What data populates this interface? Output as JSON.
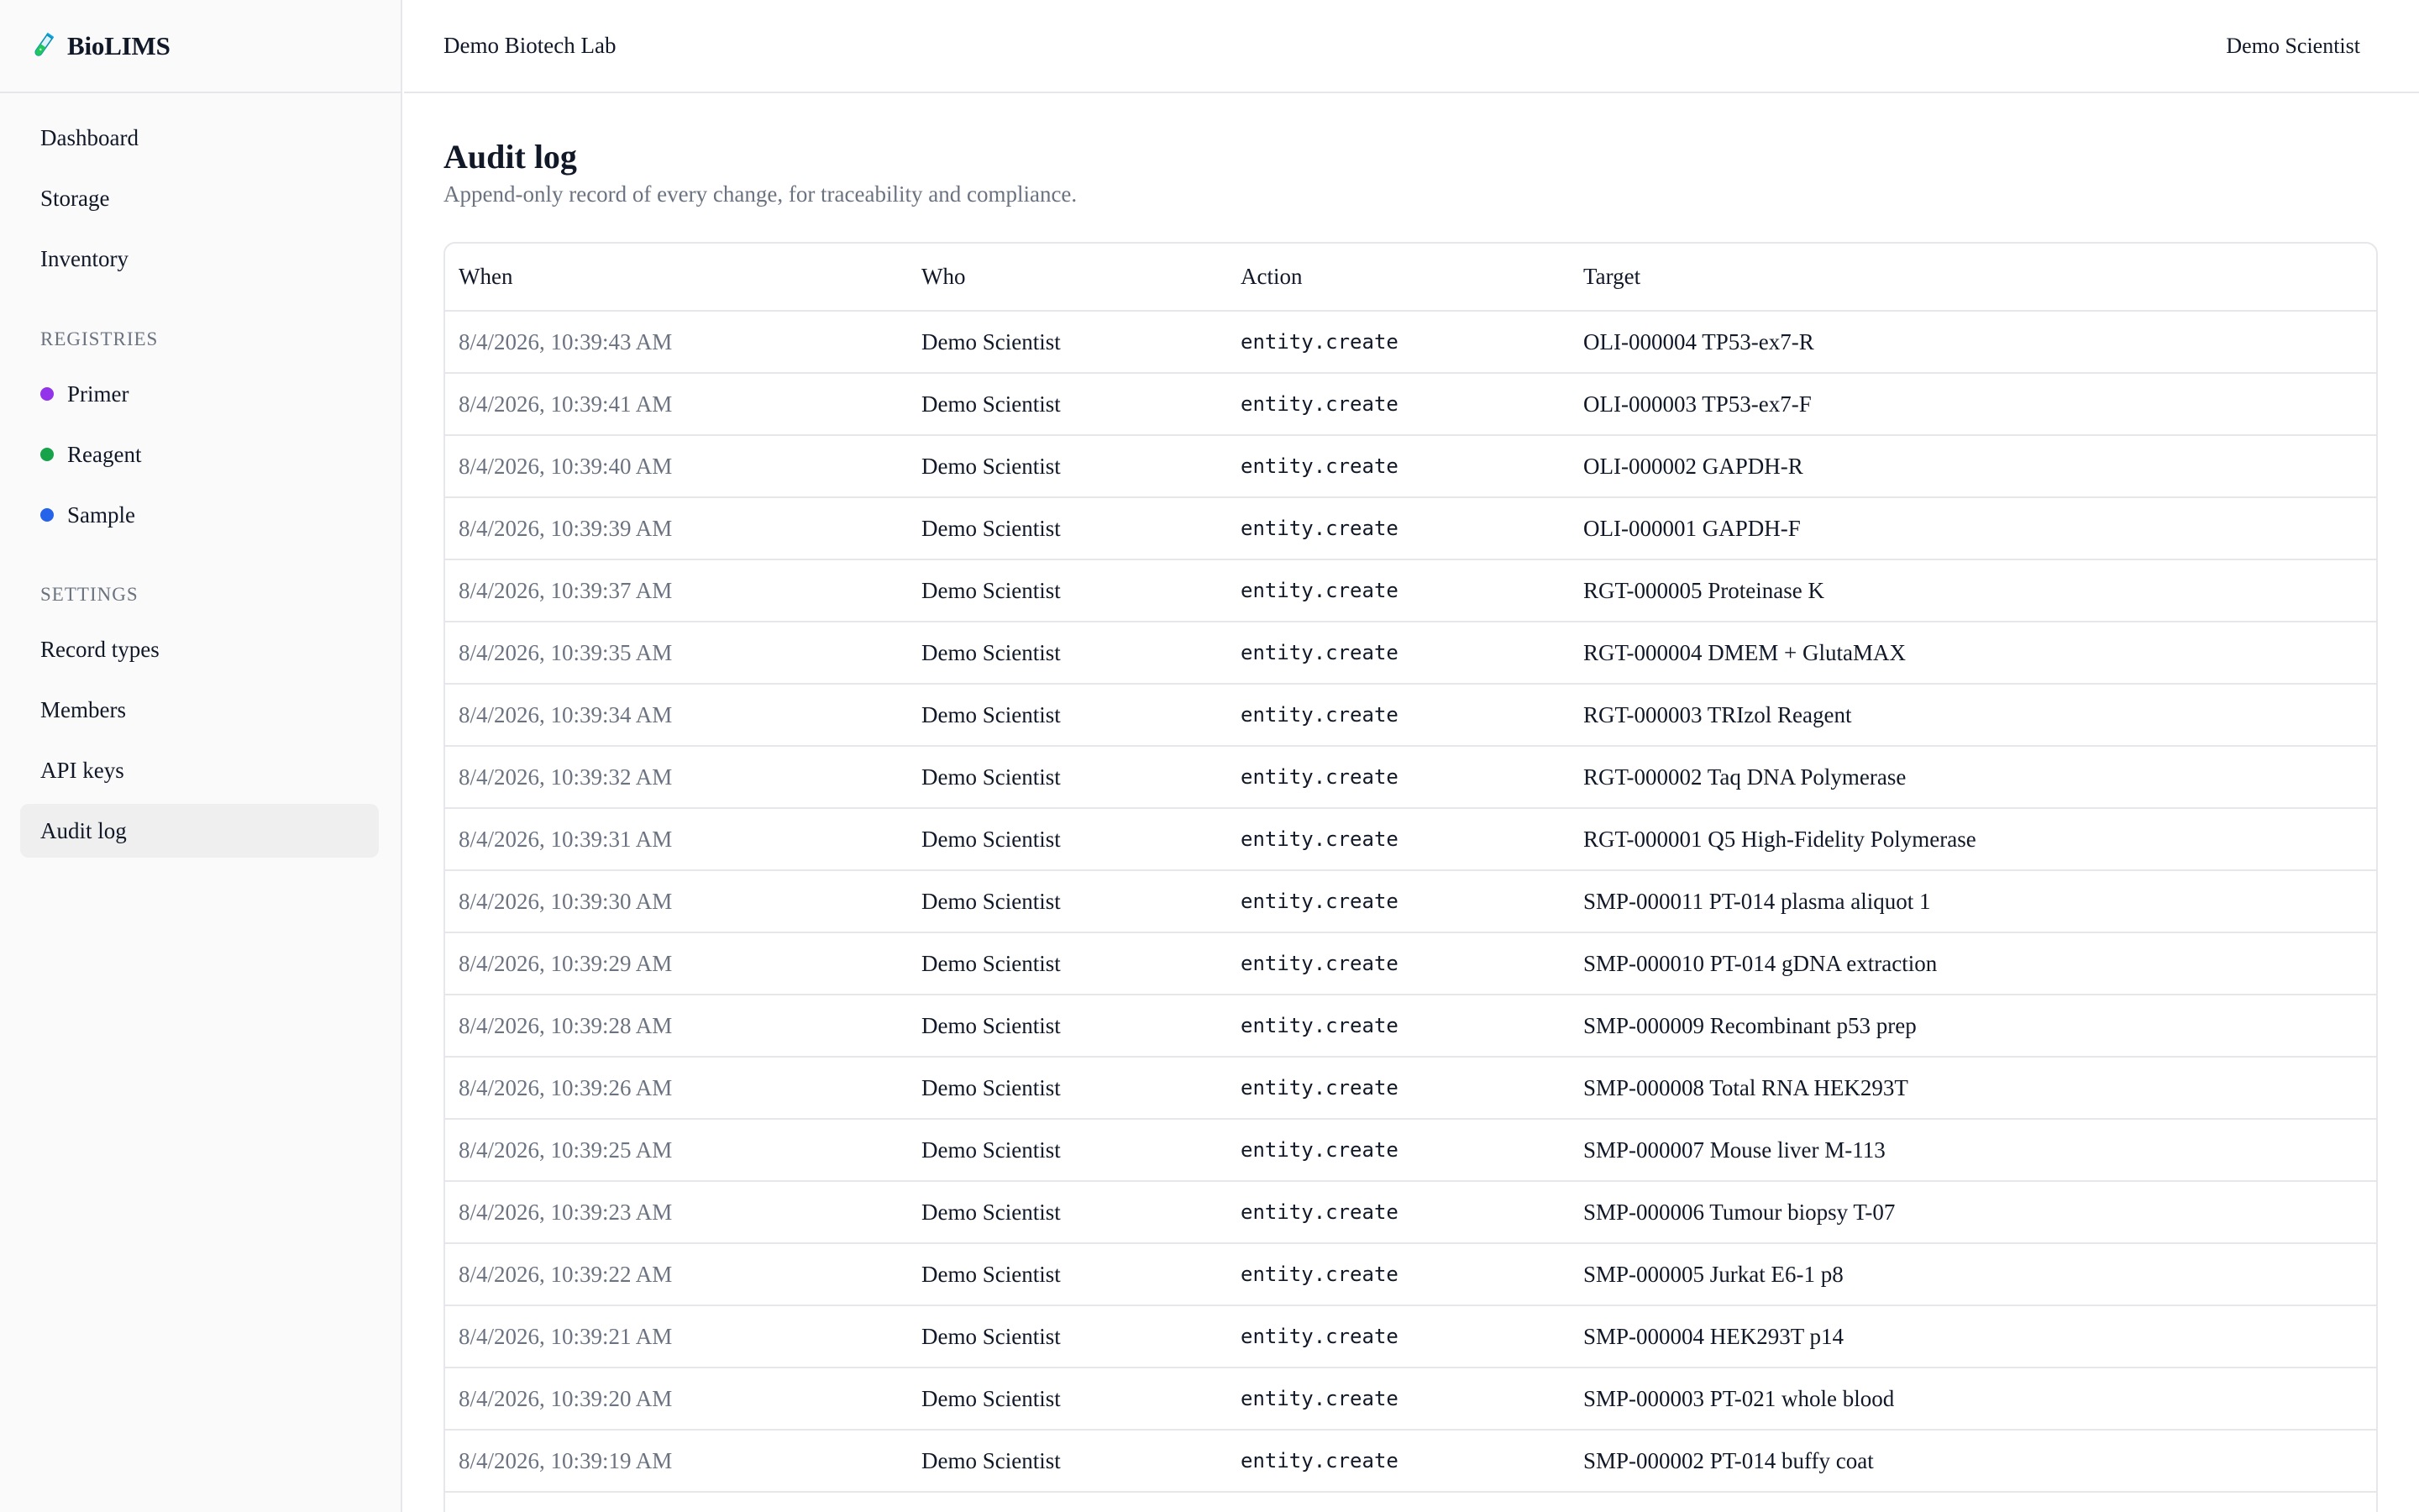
{
  "brand": {
    "name": "BioLIMS",
    "icon": "test-tube-icon"
  },
  "header": {
    "org": "Demo Biotech Lab",
    "user": "Demo Scientist"
  },
  "sidebar": {
    "items": [
      {
        "label": "Dashboard"
      },
      {
        "label": "Storage"
      },
      {
        "label": "Inventory"
      }
    ],
    "registries_title": "REGISTRIES",
    "registries": [
      {
        "label": "Primer",
        "color": "#9333ea"
      },
      {
        "label": "Reagent",
        "color": "#16a34a"
      },
      {
        "label": "Sample",
        "color": "#2563eb"
      }
    ],
    "settings_title": "SETTINGS",
    "settings": [
      {
        "label": "Record types"
      },
      {
        "label": "Members"
      },
      {
        "label": "API keys"
      },
      {
        "label": "Audit log",
        "active": true
      }
    ]
  },
  "main": {
    "title": "Audit log",
    "subtitle": "Append-only record of every change, for traceability and compliance.",
    "columns": [
      "When",
      "Who",
      "Action",
      "Target"
    ],
    "rows": [
      {
        "when": "8/4/2026, 10:39:43 AM",
        "who": "Demo Scientist",
        "action": "entity.create",
        "target": "OLI-000004 TP53-ex7-R"
      },
      {
        "when": "8/4/2026, 10:39:41 AM",
        "who": "Demo Scientist",
        "action": "entity.create",
        "target": "OLI-000003 TP53-ex7-F"
      },
      {
        "when": "8/4/2026, 10:39:40 AM",
        "who": "Demo Scientist",
        "action": "entity.create",
        "target": "OLI-000002 GAPDH-R"
      },
      {
        "when": "8/4/2026, 10:39:39 AM",
        "who": "Demo Scientist",
        "action": "entity.create",
        "target": "OLI-000001 GAPDH-F"
      },
      {
        "when": "8/4/2026, 10:39:37 AM",
        "who": "Demo Scientist",
        "action": "entity.create",
        "target": "RGT-000005 Proteinase K"
      },
      {
        "when": "8/4/2026, 10:39:35 AM",
        "who": "Demo Scientist",
        "action": "entity.create",
        "target": "RGT-000004 DMEM + GlutaMAX"
      },
      {
        "when": "8/4/2026, 10:39:34 AM",
        "who": "Demo Scientist",
        "action": "entity.create",
        "target": "RGT-000003 TRIzol Reagent"
      },
      {
        "when": "8/4/2026, 10:39:32 AM",
        "who": "Demo Scientist",
        "action": "entity.create",
        "target": "RGT-000002 Taq DNA Polymerase"
      },
      {
        "when": "8/4/2026, 10:39:31 AM",
        "who": "Demo Scientist",
        "action": "entity.create",
        "target": "RGT-000001 Q5 High-Fidelity Polymerase"
      },
      {
        "when": "8/4/2026, 10:39:30 AM",
        "who": "Demo Scientist",
        "action": "entity.create",
        "target": "SMP-000011 PT-014 plasma aliquot 1"
      },
      {
        "when": "8/4/2026, 10:39:29 AM",
        "who": "Demo Scientist",
        "action": "entity.create",
        "target": "SMP-000010 PT-014 gDNA extraction"
      },
      {
        "when": "8/4/2026, 10:39:28 AM",
        "who": "Demo Scientist",
        "action": "entity.create",
        "target": "SMP-000009 Recombinant p53 prep"
      },
      {
        "when": "8/4/2026, 10:39:26 AM",
        "who": "Demo Scientist",
        "action": "entity.create",
        "target": "SMP-000008 Total RNA HEK293T"
      },
      {
        "when": "8/4/2026, 10:39:25 AM",
        "who": "Demo Scientist",
        "action": "entity.create",
        "target": "SMP-000007 Mouse liver M-113"
      },
      {
        "when": "8/4/2026, 10:39:23 AM",
        "who": "Demo Scientist",
        "action": "entity.create",
        "target": "SMP-000006 Tumour biopsy T-07"
      },
      {
        "when": "8/4/2026, 10:39:22 AM",
        "who": "Demo Scientist",
        "action": "entity.create",
        "target": "SMP-000005 Jurkat E6-1 p8"
      },
      {
        "when": "8/4/2026, 10:39:21 AM",
        "who": "Demo Scientist",
        "action": "entity.create",
        "target": "SMP-000004 HEK293T p14"
      },
      {
        "when": "8/4/2026, 10:39:20 AM",
        "who": "Demo Scientist",
        "action": "entity.create",
        "target": "SMP-000003 PT-021 whole blood"
      },
      {
        "when": "8/4/2026, 10:39:19 AM",
        "who": "Demo Scientist",
        "action": "entity.create",
        "target": "SMP-000002 PT-014 buffy coat"
      }
    ]
  }
}
